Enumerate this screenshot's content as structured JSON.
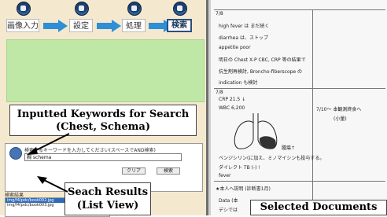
{
  "toolbar": {
    "steps": [
      {
        "label": "画像入力"
      },
      {
        "label": "設定"
      },
      {
        "label": "処理"
      },
      {
        "label": "検索"
      }
    ]
  },
  "callouts": {
    "keywords_line1": "Inputted Keywords for Search",
    "keywords_line2": "(Chest, Schema)",
    "results_line1": "Seach Results",
    "results_line2": "(List View)",
    "documents": "Selected Documents"
  },
  "search": {
    "prompt": "検索するキーワードを入力してください(スペースでAND検索)",
    "value": "胸 schema",
    "clear_label": "クリア",
    "search_label": "検索",
    "results_label": "検索結果",
    "results": [
      "img/f4/pdc/book002.jpg",
      "img/f4/pdc/book003.jpg"
    ]
  },
  "document": {
    "date1": "7/8",
    "lines1": [
      "high fever は まだ続く",
      "diarrhea は、ストップ",
      "appetite poor",
      "明日の Chest X-P CBC, CRP 等の結果で",
      "抗生剤再検討, Broncho-fiberscope の",
      "indication も検討"
    ],
    "date2": "7/8",
    "lines2": [
      "CRP 21.5 ↓",
      "WBC 6,200"
    ],
    "side_note": "7/10～ 本観測終食へ",
    "side_note2": "(小量)",
    "lung_label": "腫瘍↑",
    "lines3": [
      "ベンジシリン(に加え、ミノマイシンも投与する。",
      "ダイレクト TB (-) !",
      "fever"
    ],
    "section": "★本人へ説明 (診断書1月)",
    "lines4": [
      "Data (本",
      "デシでは"
    ]
  }
}
